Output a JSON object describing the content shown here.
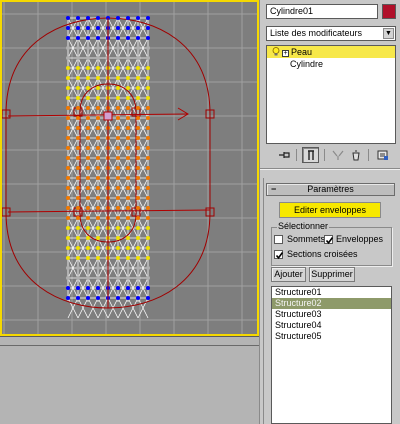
{
  "object_name": "Cylindre01",
  "object_color": "#b0102a",
  "modifier_list": {
    "label": "Liste des modificateurs",
    "arrow": "▼"
  },
  "stack": {
    "items": [
      {
        "label": "Peau",
        "selected": true,
        "toggle": "+"
      },
      {
        "label": "Cylindre",
        "selected": false
      }
    ]
  },
  "stack_tools": {
    "icons": [
      "pin-stack-icon",
      "show-end-result-icon",
      "make-unique-icon",
      "remove-modifier-icon",
      "configure-sets-icon"
    ]
  },
  "rollout": {
    "collapse": "−",
    "title": "Paramètres",
    "edit_envelopes": "Editer enveloppes",
    "select_group": {
      "label": "Sélectionner",
      "sommets": {
        "label": "Sommets",
        "checked": false
      },
      "enveloppes": {
        "label": "Enveloppes",
        "checked": true
      },
      "sections": {
        "label": "Sections croisées",
        "checked": true
      }
    },
    "add_button": "Ajouter",
    "remove_button": "Supprimer",
    "bones": [
      "Structure01",
      "Structure02",
      "Structure03",
      "Structure04",
      "Structure05"
    ],
    "selected_bone": "Structure02"
  },
  "viewport": {
    "accent_color": "#f5d800",
    "background": "#7e7e7e",
    "envelope_color": "#a00000",
    "vertex_colors": [
      "#0000ff",
      "#f07800",
      "#f0e000",
      "#b0b0b0"
    ]
  }
}
